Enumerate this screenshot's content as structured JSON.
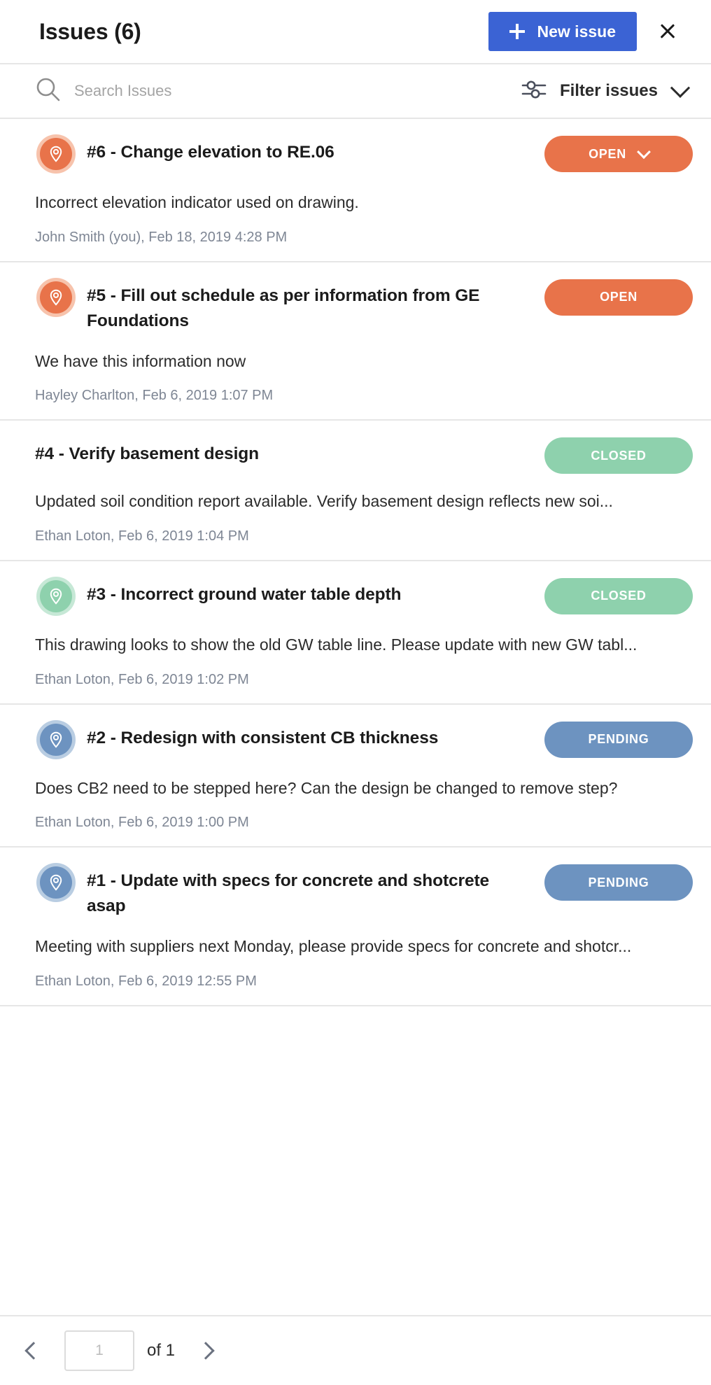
{
  "header": {
    "title": "Issues (6)",
    "new_issue_label": "New issue",
    "plus_icon": "plus-icon",
    "close_icon": "close-icon"
  },
  "search": {
    "placeholder": "Search Issues",
    "value": "",
    "search_icon": "search-icon",
    "filter_label": "Filter issues",
    "filter_icon": "filter-sliders-icon",
    "chevron_icon": "chevron-down-icon"
  },
  "colors": {
    "accent_blue": "#3b63d4",
    "status_open": "#e8734a",
    "status_open_ring": "#f7c3ac",
    "status_closed": "#8ed1ad",
    "status_closed_ring": "#c6e8d6",
    "status_pending": "#6d93c0",
    "status_pending_ring": "#b9cde2",
    "border": "#e6e6e6",
    "meta_text": "#7e8694"
  },
  "issues": [
    {
      "title": "#6 - Change elevation to RE.06",
      "description": "Incorrect elevation indicator used on drawing.",
      "meta": "John Smith (you),  Feb 18, 2019 4:28 PM",
      "status": "OPEN",
      "status_color": "#e8734a",
      "ring_color": "#f7c3ac",
      "has_pin": true,
      "has_chevron": true,
      "pin_icon": "map-pin-icon"
    },
    {
      "title": "#5 - Fill out schedule as per information from GE Foundations",
      "description": "We have this information now",
      "meta": "Hayley Charlton,  Feb 6, 2019 1:07 PM",
      "status": "OPEN",
      "status_color": "#e8734a",
      "ring_color": "#f7c3ac",
      "has_pin": true,
      "has_chevron": false,
      "pin_icon": "map-pin-icon"
    },
    {
      "title": "#4 - Verify basement design",
      "description": "Updated soil condition report available. Verify basement design reflects new soi...",
      "meta": "Ethan Loton,  Feb 6, 2019 1:04 PM",
      "status": "CLOSED",
      "status_color": "#8ed1ad",
      "ring_color": "#c6e8d6",
      "has_pin": false,
      "has_chevron": false,
      "pin_icon": ""
    },
    {
      "title": "#3 - Incorrect ground water table depth",
      "description": "This drawing looks to show the old GW table line. Please update with new GW tabl...",
      "meta": "Ethan Loton,  Feb 6, 2019 1:02 PM",
      "status": "CLOSED",
      "status_color": "#8ed1ad",
      "ring_color": "#c6e8d6",
      "has_pin": true,
      "has_chevron": false,
      "pin_icon": "map-pin-icon"
    },
    {
      "title": "#2 - Redesign with consistent CB thickness",
      "description": "Does CB2 need to be stepped here? Can the design be changed to remove step?",
      "meta": "Ethan Loton,  Feb 6, 2019 1:00 PM",
      "status": "PENDING",
      "status_color": "#6d93c0",
      "ring_color": "#b9cde2",
      "has_pin": true,
      "has_chevron": false,
      "pin_icon": "map-pin-icon"
    },
    {
      "title": "#1 - Update with specs for concrete and shotcrete asap",
      "description": "Meeting with suppliers next Monday, please provide specs for concrete and shotcr...",
      "meta": "Ethan Loton,  Feb 6, 2019 12:55 PM",
      "status": "PENDING",
      "status_color": "#6d93c0",
      "ring_color": "#b9cde2",
      "has_pin": true,
      "has_chevron": false,
      "pin_icon": "map-pin-icon"
    }
  ],
  "footer": {
    "prev_icon": "chevron-left-icon",
    "next_icon": "chevron-right-icon",
    "page_value": "1",
    "page_placeholder": "1",
    "of_label": "of 1"
  }
}
